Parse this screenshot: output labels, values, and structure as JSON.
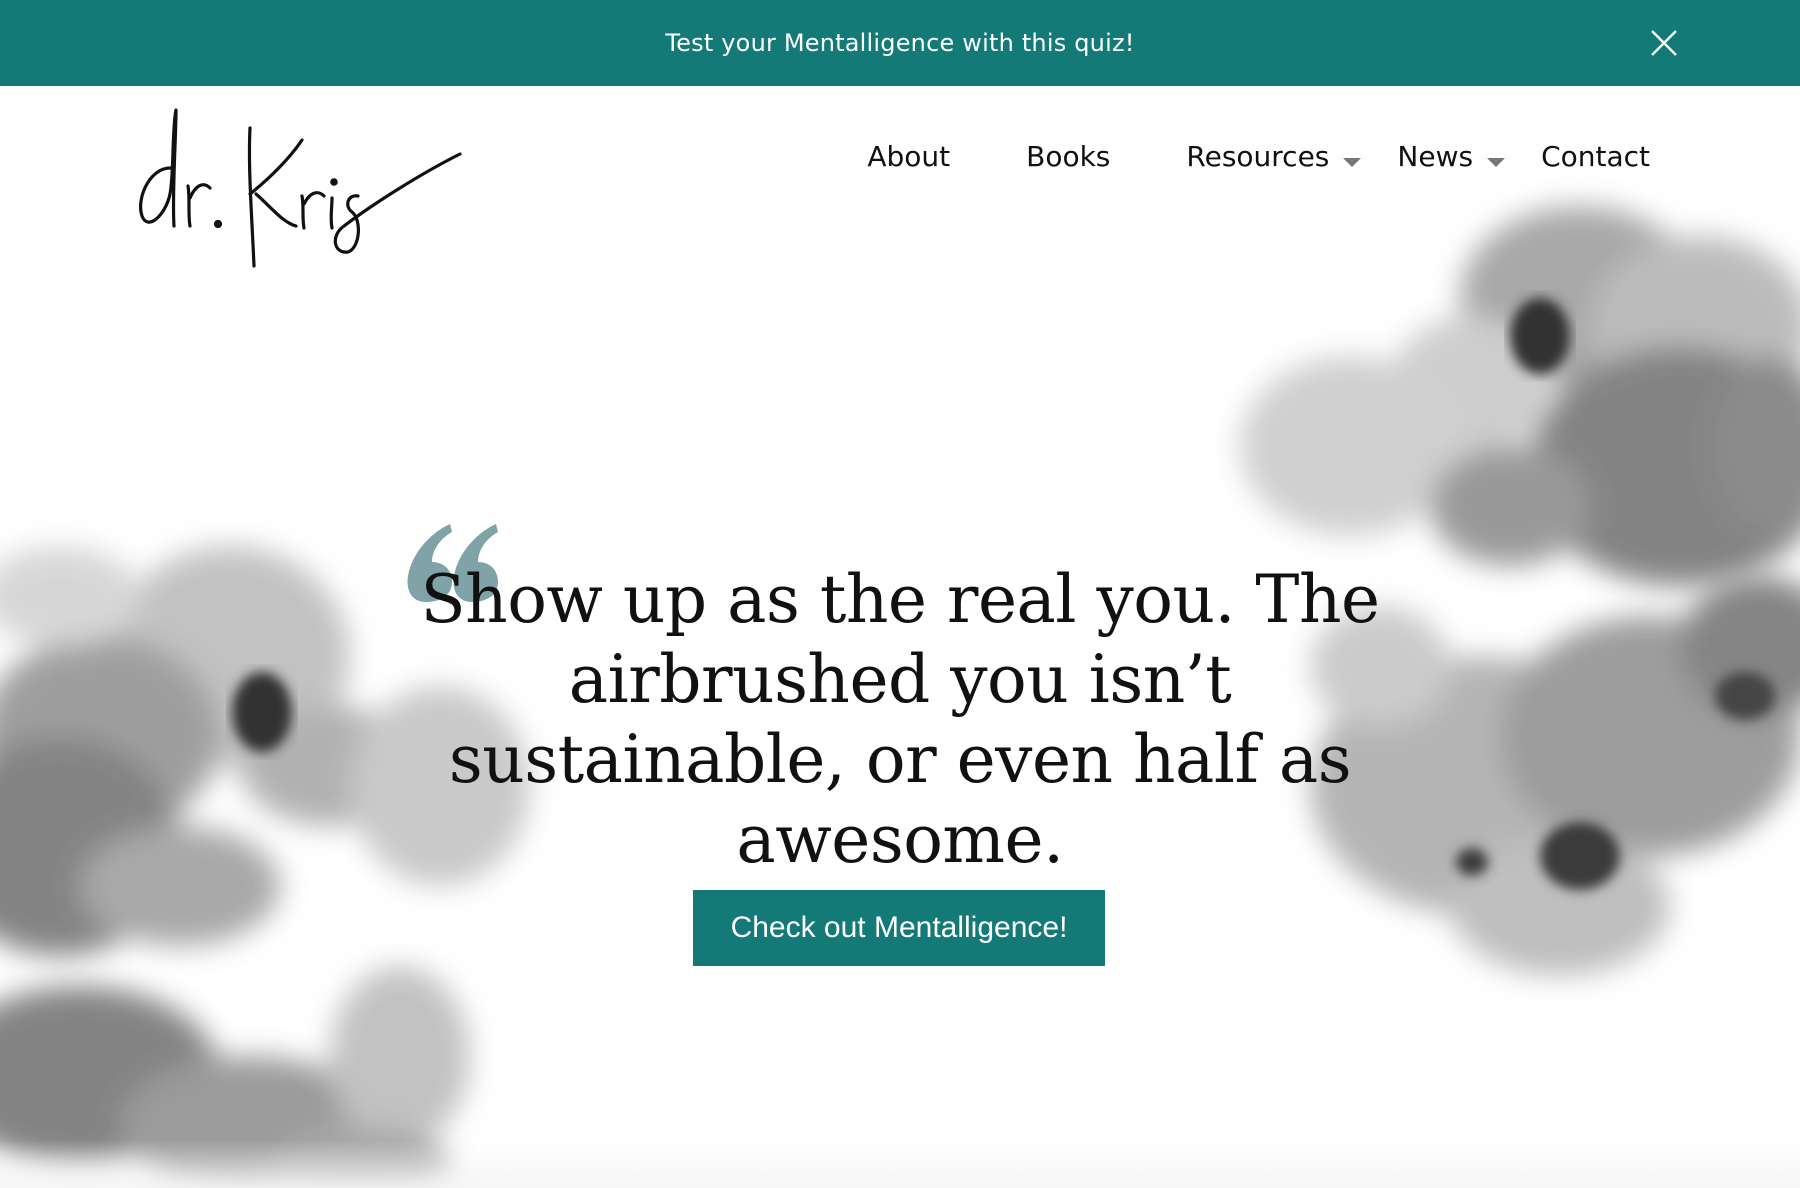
{
  "announcement": {
    "text": "Test your Mentalligence with this quiz!",
    "close_icon": "close-icon",
    "background": "#137a78"
  },
  "header": {
    "logo_text": "dr. Kris",
    "nav": [
      {
        "label": "About",
        "has_dropdown": false
      },
      {
        "label": "Books",
        "has_dropdown": false
      },
      {
        "label": "Resources",
        "has_dropdown": true
      },
      {
        "label": "News",
        "has_dropdown": true
      },
      {
        "label": "Contact",
        "has_dropdown": false
      }
    ]
  },
  "hero": {
    "quote": "Show up as the real you. The airbrushed you isn’t sustainable, or even half as awesome.",
    "quote_mark_icon": "quote-mark-icon",
    "quote_mark_color": "#7fa3a6",
    "cta_label": "Check out Mentalligence!",
    "cta_color": "#137a78"
  }
}
